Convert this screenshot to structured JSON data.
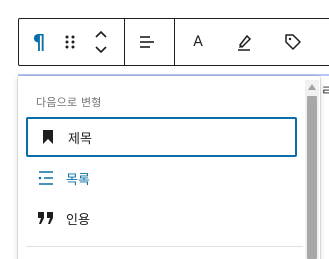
{
  "toolbar": {
    "buttons": [
      {
        "icon": "paragraph-icon",
        "label": "¶"
      },
      {
        "icon": "drag-handle-icon"
      },
      {
        "icon": "move-up-down-icon"
      },
      {
        "icon": "align-icon"
      },
      {
        "icon": "text-color-icon",
        "label": "A"
      },
      {
        "icon": "highlight-icon"
      },
      {
        "icon": "tag-icon"
      }
    ],
    "accent_color": "#0a6fa8"
  },
  "editor": {
    "edge_text": "ㄹ"
  },
  "transform_menu": {
    "heading": "다음으로 변형",
    "items": [
      {
        "label": "제목",
        "icon": "bookmark-icon",
        "state": "focused"
      },
      {
        "label": "목록",
        "icon": "list-icon",
        "state": "hover"
      },
      {
        "label": "인용",
        "icon": "quote-icon",
        "state": "normal"
      }
    ]
  }
}
